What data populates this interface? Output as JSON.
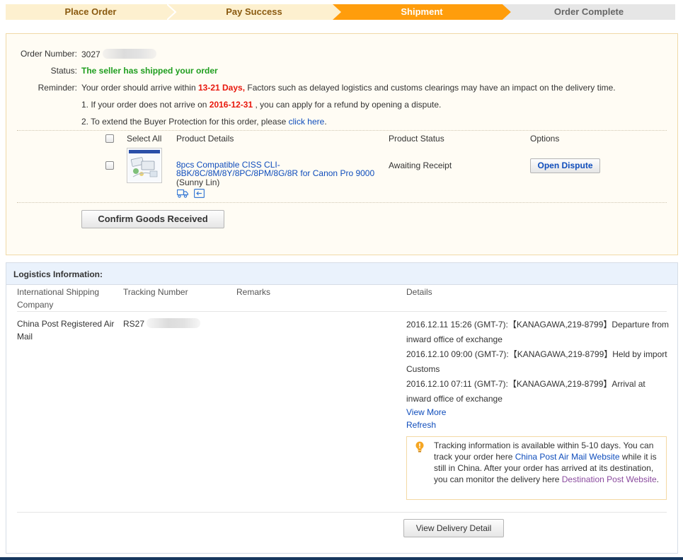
{
  "steps": [
    {
      "label": "Place Order",
      "state": "done"
    },
    {
      "label": "Pay Success",
      "state": "done"
    },
    {
      "label": "Shipment",
      "state": "current"
    },
    {
      "label": "Order Complete",
      "state": "pending"
    }
  ],
  "colors": {
    "step_done": "#fdf0cf",
    "step_current": "#ff9d0c",
    "step_pending": "#e6e6e6",
    "link": "#0f4dbc",
    "success": "#1f9e1f",
    "alert": "#e8180d"
  },
  "order": {
    "number_label": "Order Number:",
    "number_value": "3027",
    "status_label": "Status:",
    "status_value": "The seller has shipped your order",
    "reminder_label": "Reminder:",
    "reminder_pre": "Your order should arrive within ",
    "reminder_days": "13-21 Days,",
    "reminder_post": " Factors such as delayed logistics and customs clearings may have an impact on the delivery time.",
    "note1_pre": "1. If your order does not arrive on ",
    "note1_date": "2016-12-31",
    "note1_post": " , you can apply for a refund by opening a dispute.",
    "note2_pre": "2. To extend the Buyer Protection for this order, please ",
    "note2_link": "click here",
    "note2_post": "."
  },
  "products": {
    "headers": {
      "select_all": "Select All",
      "details": "Product Details",
      "status": "Product Status",
      "options": "Options"
    },
    "item": {
      "title": "8pcs Compatible CISS CLI-8BK/8C/8M/8Y/8PC/8PM/8G/8R for Canon Pro 9000",
      "seller": "(Sunny Lin)",
      "status": "Awaiting Receipt",
      "action": "Open Dispute",
      "icons": [
        "shipping-truck-icon",
        "return-arrow-icon"
      ]
    },
    "confirm_button": "Confirm Goods Received"
  },
  "logistics": {
    "title": "Logistics Information:",
    "headers": {
      "company": "International Shipping Company",
      "tracking": "Tracking Number",
      "remarks": "Remarks",
      "details": "Details"
    },
    "company": "China Post Registered Air Mail",
    "tracking_prefix": "RS27",
    "remarks": "",
    "events": [
      "2016.12.11 15:26 (GMT-7):【KANAGAWA,219-8799】Departure from inward office of exchange",
      "2016.12.10 09:00 (GMT-7):【KANAGAWA,219-8799】Held by import Customs",
      "2016.12.10 07:11 (GMT-7):【KANAGAWA,219-8799】Arrival at inward office of exchange"
    ],
    "view_more": "View More",
    "refresh": "Refresh",
    "tip": {
      "pre": "Tracking information is available within 5-10 days. You can track your order here ",
      "link1": "China Post Air Mail Website",
      "mid": " while it is still in China. After your order has arrived at its destination, you can monitor the delivery here ",
      "link2": "Destination Post Website",
      "post": "."
    },
    "view_delivery_button": "View Delivery Detail"
  }
}
